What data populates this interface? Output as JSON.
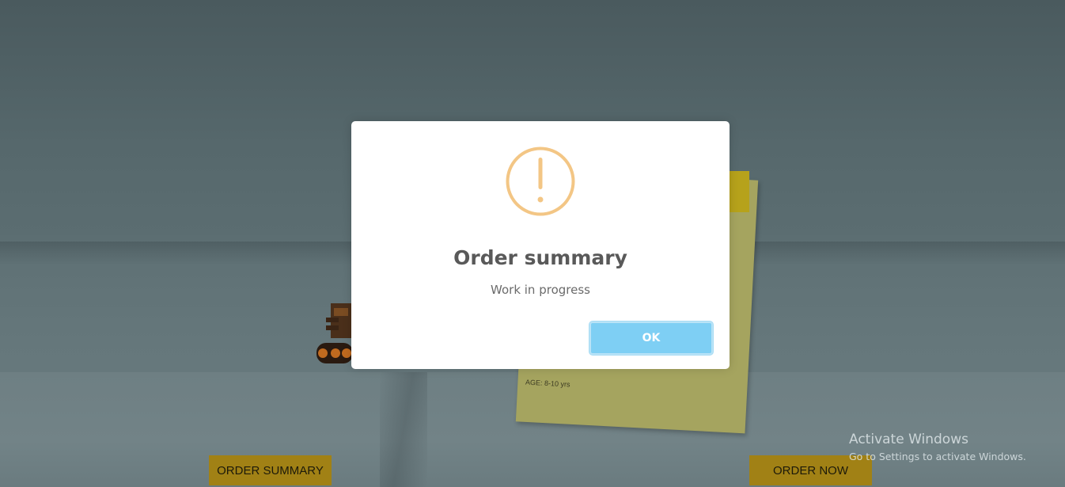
{
  "modal": {
    "title": "Order summary",
    "message": "Work in progress",
    "ok_label": "OK",
    "icon": "warning-circle-icon",
    "icon_color": "#f3c685",
    "ok_color": "#7ecff4"
  },
  "background": {
    "note_age_text": "AGE: 8-10 yrs"
  },
  "buttons": {
    "order_summary_label": "ORDER SUMMARY",
    "order_now_label": "ORDER NOW",
    "color": "#a18115"
  },
  "watermark": {
    "title": "Activate Windows",
    "subtitle": "Go to Settings to activate Windows."
  }
}
